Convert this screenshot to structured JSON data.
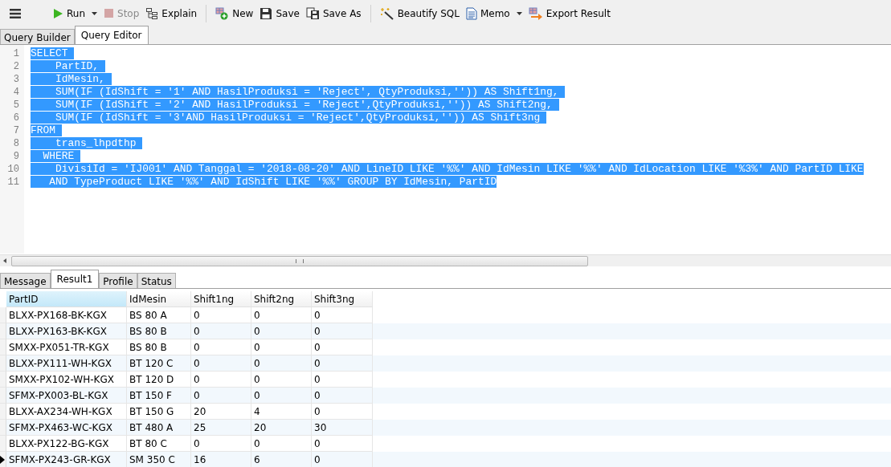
{
  "toolbar": [
    {
      "kind": "menu"
    },
    {
      "kind": "run",
      "label": "Run",
      "disabled": false
    },
    {
      "kind": "caret"
    },
    {
      "kind": "stop",
      "label": "Stop",
      "disabled": true
    },
    {
      "kind": "explain",
      "label": "Explain",
      "disabled": false
    },
    {
      "kind": "separator"
    },
    {
      "kind": "new",
      "label": "New",
      "disabled": false
    },
    {
      "kind": "save",
      "label": "Save",
      "disabled": false
    },
    {
      "kind": "saveas",
      "label": "Save As",
      "disabled": false
    },
    {
      "kind": "separator"
    },
    {
      "kind": "beautify",
      "label": "Beautify SQL",
      "disabled": false
    },
    {
      "kind": "memo",
      "label": "Memo",
      "disabled": false
    },
    {
      "kind": "caret"
    },
    {
      "kind": "export",
      "label": "Export Result",
      "disabled": false
    }
  ],
  "editor_tabs": [
    {
      "label": "Query Builder",
      "selected": false
    },
    {
      "label": "Query Editor",
      "selected": true
    }
  ],
  "editor": {
    "lines": [
      {
        "number": "1",
        "text": "SELECT ",
        "selected": true
      },
      {
        "number": "2",
        "text": "    PartID, ",
        "selected": true
      },
      {
        "number": "3",
        "text": "    IdMesin, ",
        "selected": true
      },
      {
        "number": "4",
        "text": "    SUM(IF (IdShift = '1' AND HasilProduksi = 'Reject', QtyProduksi,'')) AS Shift1ng, ",
        "selected": true
      },
      {
        "number": "5",
        "text": "    SUM(IF (IdShift = '2' AND HasilProduksi = 'Reject',QtyProduksi,'')) AS Shift2ng, ",
        "selected": true
      },
      {
        "number": "6",
        "text": "    SUM(IF (IdShift = '3'AND HasilProduksi = 'Reject',QtyProduksi,'')) AS Shift3ng ",
        "selected": true
      },
      {
        "number": "7",
        "text": "FROM ",
        "selected": true
      },
      {
        "number": "8",
        "text": "    trans_lhpdthp ",
        "selected": true
      },
      {
        "number": "9",
        "text": "  WHERE ",
        "selected": true
      },
      {
        "number": "10",
        "text": "    DivisiId = 'IJ001' AND Tanggal = '2018-08-20' AND LineID LIKE '%%' AND IdMesin LIKE '%%' AND IdLocation LIKE '%3%' AND PartID LIKE",
        "selected": true
      },
      {
        "number": "11",
        "text": "   AND TypeProduct LIKE '%%' AND IdShift LIKE '%%' GROUP BY IdMesin, PartID",
        "selected": true
      }
    ]
  },
  "result_tabs": [
    {
      "label": "Message",
      "selected": false
    },
    {
      "label": "Result1",
      "selected": true
    },
    {
      "label": "Profile",
      "selected": false
    },
    {
      "label": "Status",
      "selected": false
    }
  ],
  "table": {
    "columns": [
      {
        "label": "PartID",
        "selected": true
      },
      {
        "label": "IdMesin",
        "selected": false
      },
      {
        "label": "Shift1ng",
        "selected": false
      },
      {
        "label": "Shift2ng",
        "selected": false
      },
      {
        "label": "Shift3ng",
        "selected": false
      }
    ],
    "rows": [
      {
        "cells": [
          "BLXX-PX168-BK-KGX",
          "BS 80 A",
          "0",
          "0",
          "0"
        ],
        "current": false
      },
      {
        "cells": [
          "BLXX-PX163-BK-KGX",
          "BS 80 B",
          "0",
          "0",
          "0"
        ],
        "current": false
      },
      {
        "cells": [
          "SMXX-PX051-TR-KGX",
          "BS 80 B",
          "0",
          "0",
          "0"
        ],
        "current": false
      },
      {
        "cells": [
          "BLXX-PX111-WH-KGX",
          "BT 120 C",
          "0",
          "0",
          "0"
        ],
        "current": false
      },
      {
        "cells": [
          "SMXX-PX102-WH-KGX",
          "BT 120 D",
          "0",
          "0",
          "0"
        ],
        "current": false
      },
      {
        "cells": [
          "SFMX-PX003-BL-KGX",
          "BT 150 F",
          "0",
          "0",
          "0"
        ],
        "current": false
      },
      {
        "cells": [
          "BLXX-AX234-WH-KGX",
          "BT 150 G",
          "20",
          "4",
          "0"
        ],
        "current": false
      },
      {
        "cells": [
          "SFMX-PX463-WC-KGX",
          "BT 480 A",
          "25",
          "20",
          "30"
        ],
        "current": false
      },
      {
        "cells": [
          "BLXX-PX122-BG-KGX",
          "BT 80 C",
          "0",
          "0",
          "0"
        ],
        "current": false
      },
      {
        "cells": [
          "SFMX-PX243-GR-KGX",
          "SM 350 C",
          "16",
          "6",
          "0"
        ],
        "current": true
      }
    ]
  }
}
